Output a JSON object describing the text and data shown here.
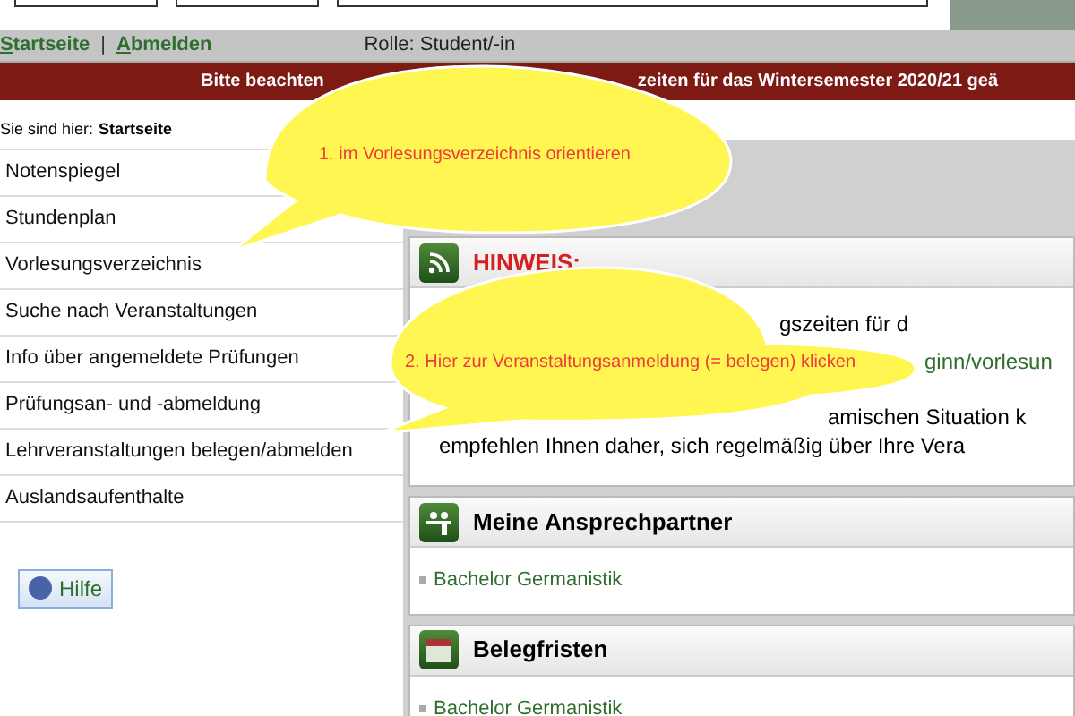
{
  "nav": {
    "links": [
      "Startseite",
      "Abmelden"
    ],
    "separator": "|",
    "role": "Rolle: Student/-in"
  },
  "banner": {
    "left": "Bitte beachten",
    "right": "zeiten für das Wintersemester 2020/21 geä"
  },
  "breadcrumb": {
    "label": "Sie sind hier:",
    "current": "Startseite"
  },
  "menu": [
    {
      "label": "Notenspiegel"
    },
    {
      "label": "Stundenplan"
    },
    {
      "label": "Vorlesungsverzeichnis"
    },
    {
      "label": "Suche nach Veranstaltungen"
    },
    {
      "label": "Info über angemeldete Prüfungen"
    },
    {
      "label": "Prüfungsan- und -abmeldung"
    },
    {
      "label": "Lehrveranstaltungen belegen/abmelden"
    },
    {
      "label": "Auslandsaufenthalte"
    }
  ],
  "help_button": "Hilfe",
  "panels": [
    {
      "kind": "notice",
      "title": "HINWEIS:",
      "lines": [
        {
          "kind": "text",
          "text": "gszeiten für d"
        },
        {
          "kind": "link",
          "text": "ginn/vorlesun"
        },
        {
          "kind": "text",
          "text": "amischen Situation k"
        },
        {
          "kind": "full",
          "text": "empfehlen Ihnen daher, sich regelmäßig über Ihre Vera"
        }
      ]
    },
    {
      "kind": "contacts",
      "title": "Meine Ansprechpartner",
      "links": [
        "Bachelor Germanistik"
      ]
    },
    {
      "kind": "calendar",
      "title": "Belegfristen",
      "links": [
        "Bachelor Germanistik"
      ]
    }
  ],
  "callouts": [
    "1. im Vorlesungsverzeichnis orientieren",
    "2. Hier zur Veranstaltungsanmeldung (= belegen) klicken"
  ]
}
